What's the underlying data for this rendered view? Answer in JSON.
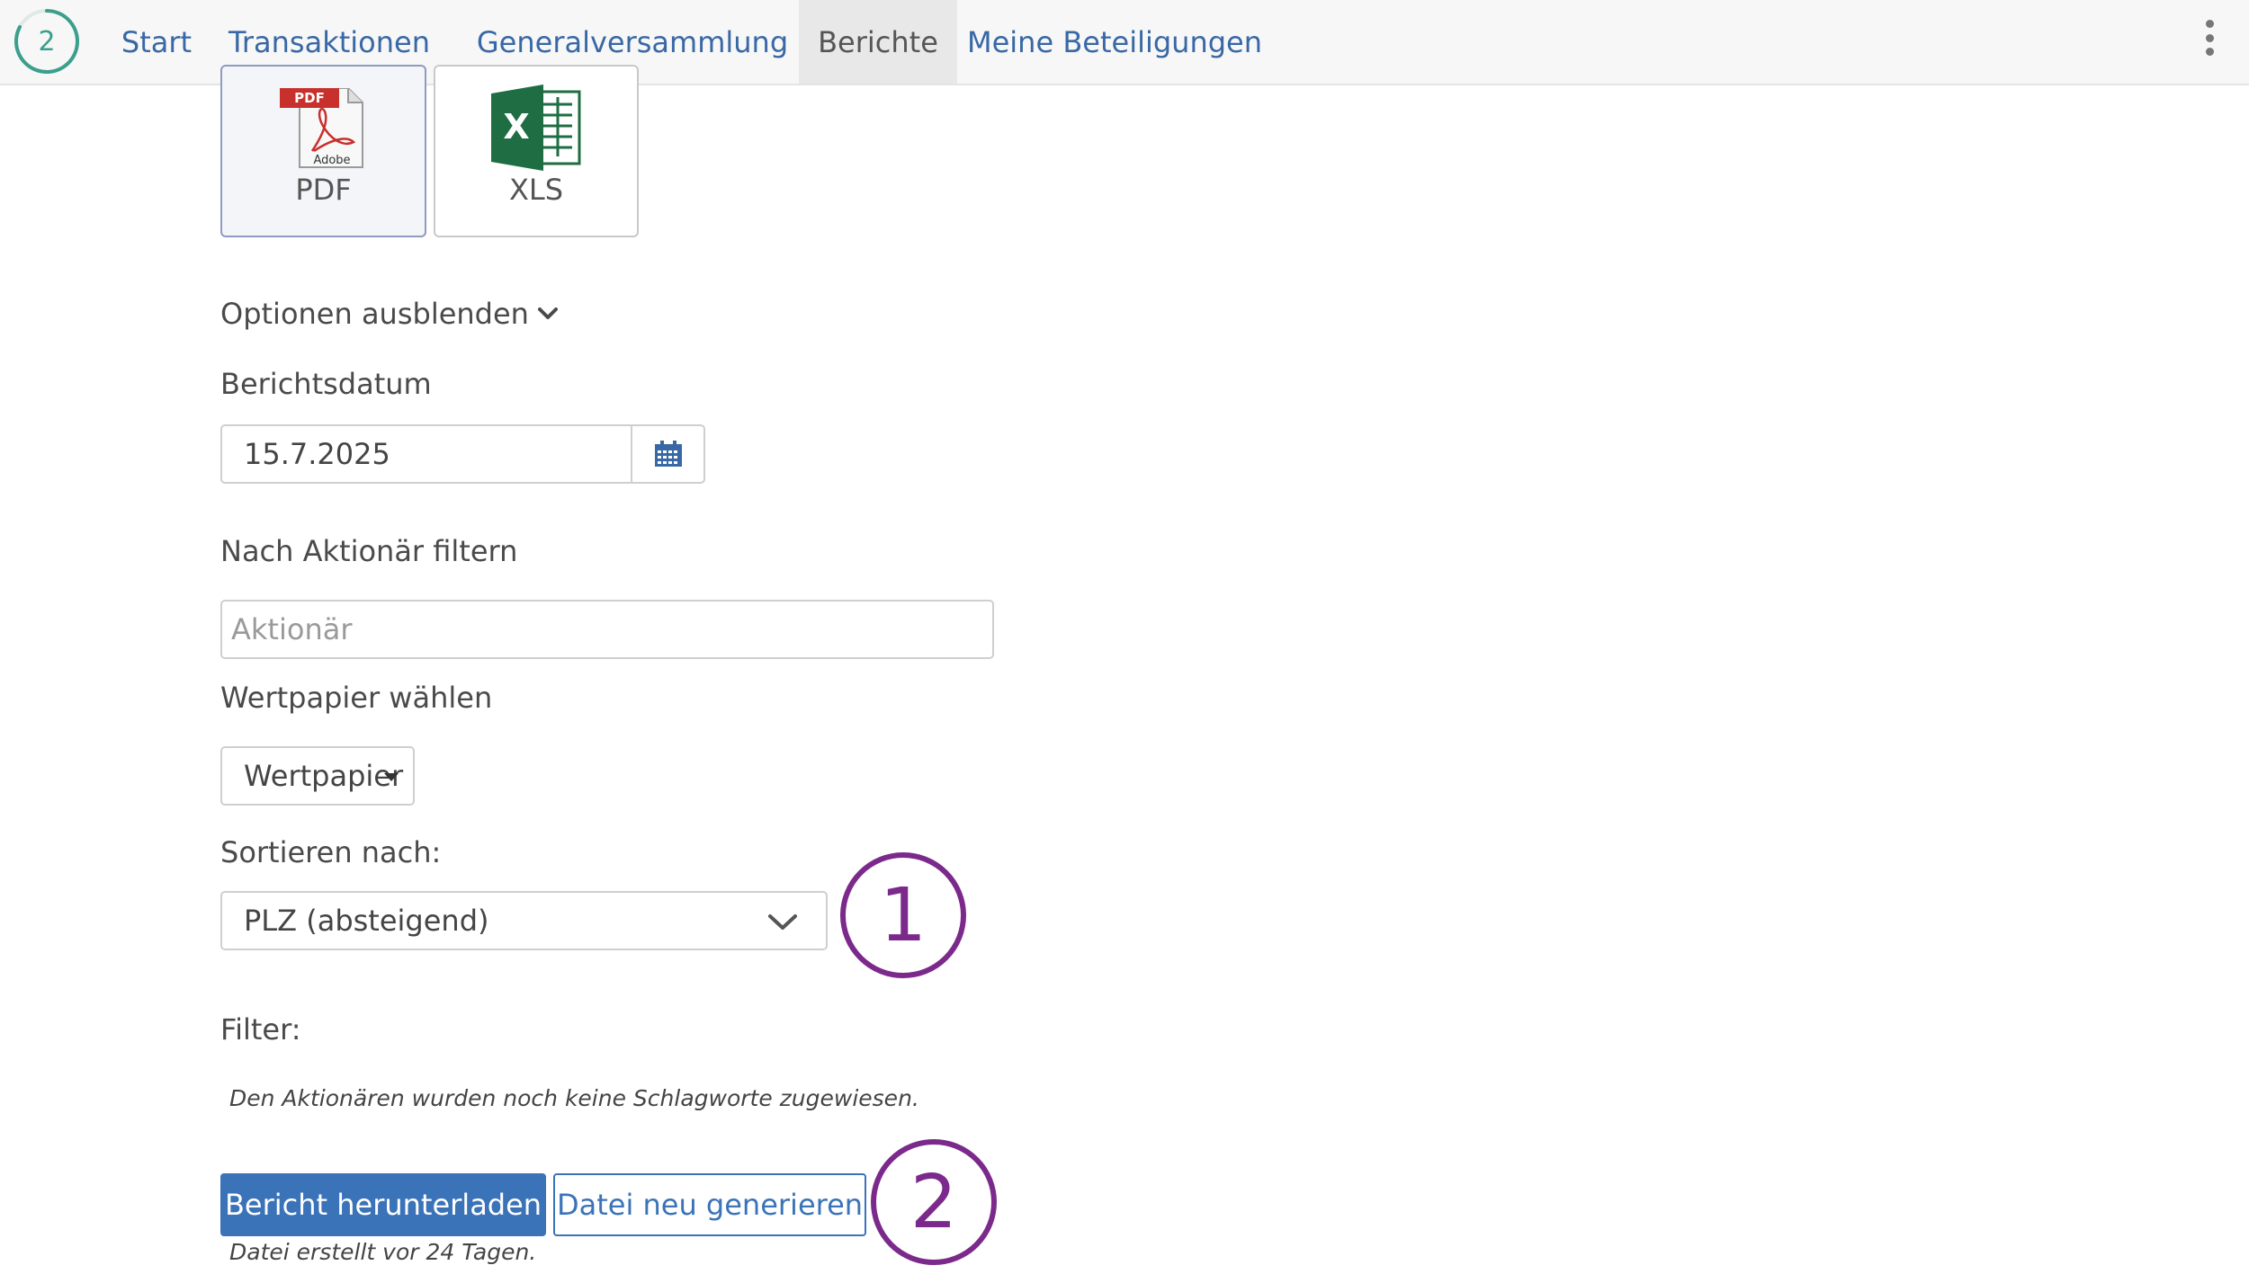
{
  "nav": {
    "logo_text": "2",
    "items": [
      {
        "label": "Start",
        "active": false
      },
      {
        "label": "Transaktionen",
        "active": false
      },
      {
        "label": "Generalversammlung",
        "active": false
      },
      {
        "label": "Berichte",
        "active": true
      },
      {
        "label": "Meine Beteiligungen",
        "active": false
      }
    ],
    "menu_icon": "kebab-menu-icon"
  },
  "formats": [
    {
      "label": "PDF",
      "icon": "pdf-file-icon",
      "icon_text": "PDF",
      "icon_subtext": "Adobe",
      "selected": true
    },
    {
      "label": "XLS",
      "icon": "excel-file-icon",
      "icon_text": "X",
      "selected": false
    }
  ],
  "options": {
    "toggle_label": "Optionen ausblenden",
    "report_date": {
      "label": "Berichtsdatum",
      "value": "15.7.2025"
    },
    "shareholder_filter": {
      "label": "Nach Aktionär filtern",
      "placeholder": "Aktionär"
    },
    "security": {
      "label": "Wertpapier wählen",
      "value": "Wertpapier"
    },
    "sort": {
      "label": "Sortieren nach:",
      "value": "PLZ (absteigend)"
    },
    "filter": {
      "label": "Filter:",
      "note": "Den Aktionären wurden noch keine Schlagworte zugewiesen."
    }
  },
  "actions": {
    "download_label": "Bericht herunterladen",
    "regenerate_label": "Datei neu generieren",
    "file_note": "Datei erstellt vor 24 Tagen."
  },
  "annotations": [
    "1",
    "2"
  ],
  "colors": {
    "nav_link": "#3868a5",
    "primary": "#3b73b9",
    "annotation": "#7b2a8c",
    "logo": "#3a9f8c"
  }
}
